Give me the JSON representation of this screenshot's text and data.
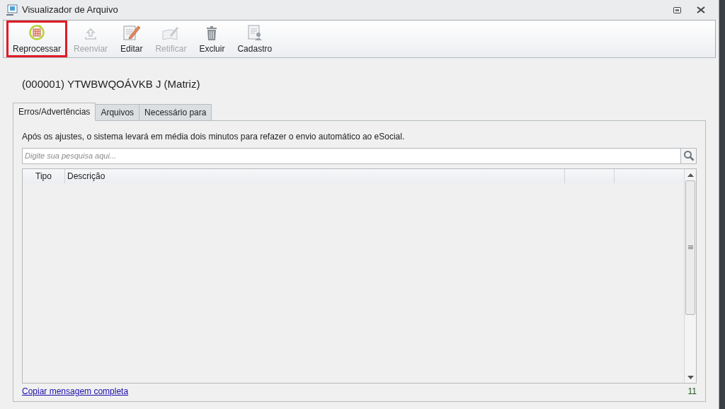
{
  "window": {
    "title": "Visualizador de Arquivo"
  },
  "toolbar": [
    {
      "kind": "reprocess",
      "label": "Reprocessar",
      "disabled": false,
      "highlighted": true
    },
    {
      "kind": "upload",
      "label": "Reenviar",
      "disabled": true,
      "highlighted": false
    },
    {
      "kind": "edit",
      "label": "Editar",
      "disabled": false,
      "highlighted": false
    },
    {
      "kind": "rectify",
      "label": "Retificar",
      "disabled": true,
      "highlighted": false
    },
    {
      "kind": "delete",
      "label": "Excluir",
      "disabled": false,
      "highlighted": false
    },
    {
      "kind": "record",
      "label": "Cadastro",
      "disabled": false,
      "highlighted": false
    }
  ],
  "heading": "(000001) YTWBWQOÁVKB J (Matriz)",
  "tabs": [
    {
      "label": "Erros/Advertências",
      "selected": true
    },
    {
      "label": "Arquivos",
      "selected": false
    },
    {
      "label": "Necessário para",
      "selected": false
    }
  ],
  "notice": "Após os ajustes, o sistema levará em média dois minutos para refazer o envio automático ao eSocial.",
  "search": {
    "placeholder": "Digite sua pesquisa aqui..."
  },
  "table": {
    "columns": [
      "Tipo",
      "Descrição"
    ]
  },
  "footer": {
    "link": "Copiar mensagem completa",
    "count": "11"
  }
}
